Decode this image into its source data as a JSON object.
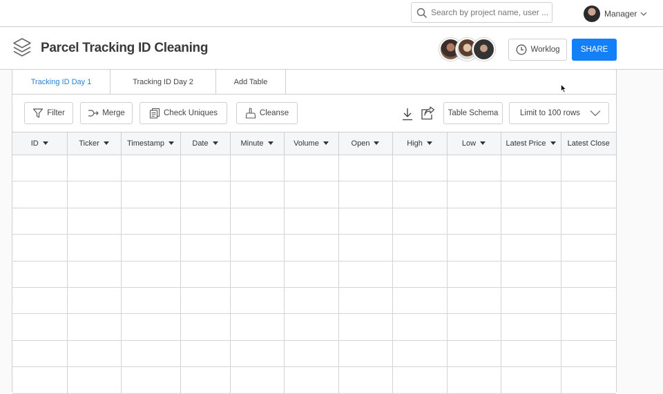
{
  "search": {
    "placeholder": "Search by project name, user ..."
  },
  "user": {
    "name": "Manager"
  },
  "project": {
    "title": "Parcel Tracking ID Cleaning"
  },
  "header_actions": {
    "worklog": "Worklog",
    "share": "SHARE"
  },
  "tabs": [
    {
      "label": "Tracking ID Day 1",
      "active": true
    },
    {
      "label": "Tracking ID Day 2",
      "active": false
    },
    {
      "label": "Add Table",
      "active": false
    }
  ],
  "toolbar": {
    "filter": "Filter",
    "merge": "Merge",
    "check_uniques": "Check Uniques",
    "cleanse": "Cleanse",
    "table_schema": "Table Schema",
    "limit_select": "Limit to 100 rows"
  },
  "table": {
    "columns": [
      "ID",
      "Ticker",
      "Timestamp",
      "Date",
      "Minute",
      "Volume",
      "Open",
      "High",
      "Low",
      "Latest Price",
      "Latest Close"
    ]
  },
  "colors": {
    "accent": "#1380f8",
    "active_tab": "#2a7fd4"
  }
}
